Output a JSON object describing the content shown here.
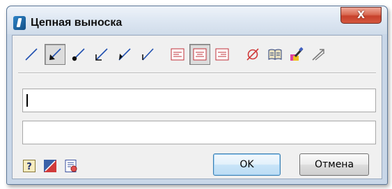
{
  "window": {
    "title": "Цепная выноска",
    "close_glyph": "X",
    "app_icon": "autocad-style-app-icon"
  },
  "toolbar": {
    "items": [
      {
        "name": "leader-line-plain",
        "icon": "diagonal-line-icon",
        "pressed": false
      },
      {
        "name": "leader-arrow",
        "icon": "arrow-line-icon",
        "pressed": true
      },
      {
        "name": "leader-dot",
        "icon": "dot-line-icon",
        "pressed": false
      },
      {
        "name": "leader-open-arrow",
        "icon": "open-arrow-line-icon",
        "pressed": false
      },
      {
        "name": "leader-half-arrow",
        "icon": "half-arrow-line-icon",
        "pressed": false
      },
      {
        "name": "leader-tick",
        "icon": "tick-line-icon",
        "pressed": false
      },
      {
        "name": "align-left",
        "icon": "align-left-icon",
        "pressed": false
      },
      {
        "name": "align-center",
        "icon": "align-center-icon",
        "pressed": true
      },
      {
        "name": "align-right",
        "icon": "align-right-icon",
        "pressed": false
      },
      {
        "name": "diameter-symbol",
        "icon": "diameter-icon",
        "pressed": false
      },
      {
        "name": "symbol-library",
        "icon": "book-icon",
        "pressed": false
      },
      {
        "name": "text-style",
        "icon": "paint-brush-icon",
        "pressed": false
      },
      {
        "name": "leader-direction",
        "icon": "leader-arrow-icon",
        "pressed": false
      }
    ],
    "colors": {
      "accent": "#2050b0",
      "pressed_bg": "#dcdcdc"
    }
  },
  "fields": {
    "upper_value": "",
    "lower_value": ""
  },
  "footer": {
    "icons": [
      "help-icon",
      "leader-settings-icon",
      "format-sheet-icon"
    ],
    "ok_label": "OK",
    "cancel_label": "Отмена"
  }
}
